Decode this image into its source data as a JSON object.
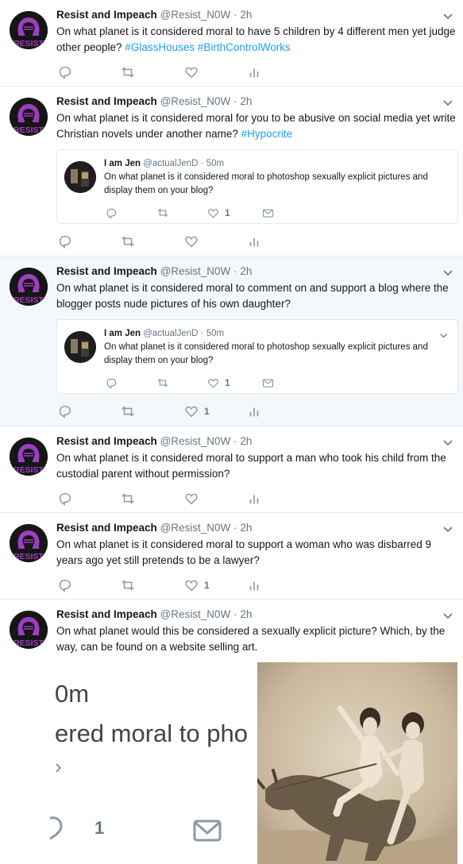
{
  "colors": {
    "link": "#1da1f2",
    "muted": "#657786",
    "border": "#e6ecf0",
    "highlight": "#f5f8fa",
    "avatar_purple": "#9b3fc0"
  },
  "avatar_label": "RESIST",
  "tweets": [
    {
      "name": "Resist and Impeach",
      "handle": "@Resist_N0W",
      "dot": "·",
      "time": "2h",
      "text": "On what planet is it considered moral to have 5 children by 4 different men yet judge other people?",
      "tags": [
        "#GlassHouses",
        "#BirthControlWorks"
      ],
      "like_count": ""
    },
    {
      "name": "Resist and Impeach",
      "handle": "@Resist_N0W",
      "dot": "·",
      "time": "2h",
      "text": "On what planet is it considered moral for you to be abusive on social media yet write Christian novels under another name?",
      "tags": [
        "#Hypocrite"
      ],
      "like_count": "",
      "quote": {
        "name": "I am Jen",
        "handle": "@actualJenD",
        "dot": "·",
        "time": "50m",
        "text": "On what planet is it considered moral to photoshop sexually explicit pictures and display them on your blog?",
        "like_count": "1"
      }
    },
    {
      "name": "Resist and Impeach",
      "handle": "@Resist_N0W",
      "dot": "·",
      "time": "2h",
      "text": "On what planet is it considered moral to comment on and support a blog where the blogger posts nude pictures of his own daughter?",
      "tags": [],
      "like_count": "1",
      "quote": {
        "name": "I am Jen",
        "handle": "@actualJenD",
        "dot": "·",
        "time": "50m",
        "text": "On what planet is it considered moral to photoshop sexually explicit pictures and display them on your blog?",
        "like_count": "1"
      }
    },
    {
      "name": "Resist and Impeach",
      "handle": "@Resist_N0W",
      "dot": "·",
      "time": "2h",
      "text": "On what planet is it considered moral to support a man who took his child from the custodial parent without permission?",
      "tags": [],
      "like_count": ""
    },
    {
      "name": "Resist and Impeach",
      "handle": "@Resist_N0W",
      "dot": "·",
      "time": "2h",
      "text": "On what planet is it considered moral to support a woman who was disbarred 9 years ago yet still pretends to be a lawyer?",
      "tags": [],
      "like_count": "1"
    },
    {
      "name": "Resist and Impeach",
      "handle": "@Resist_N0W",
      "dot": "·",
      "time": "2h",
      "text": "On what planet would this be considered a sexually explicit picture? Which, by the way, can be found on a website selling art.",
      "tags": [],
      "like_count": ""
    }
  ],
  "media_crop": {
    "line1": "0m",
    "line2": "ered moral to pho",
    "line3": "›",
    "like_count": "1"
  },
  "icons": {
    "reply": "reply-icon",
    "retweet": "retweet-icon",
    "like": "heart-icon",
    "analytics": "analytics-icon",
    "dm": "envelope-icon",
    "caret": "chevron-down-icon"
  }
}
